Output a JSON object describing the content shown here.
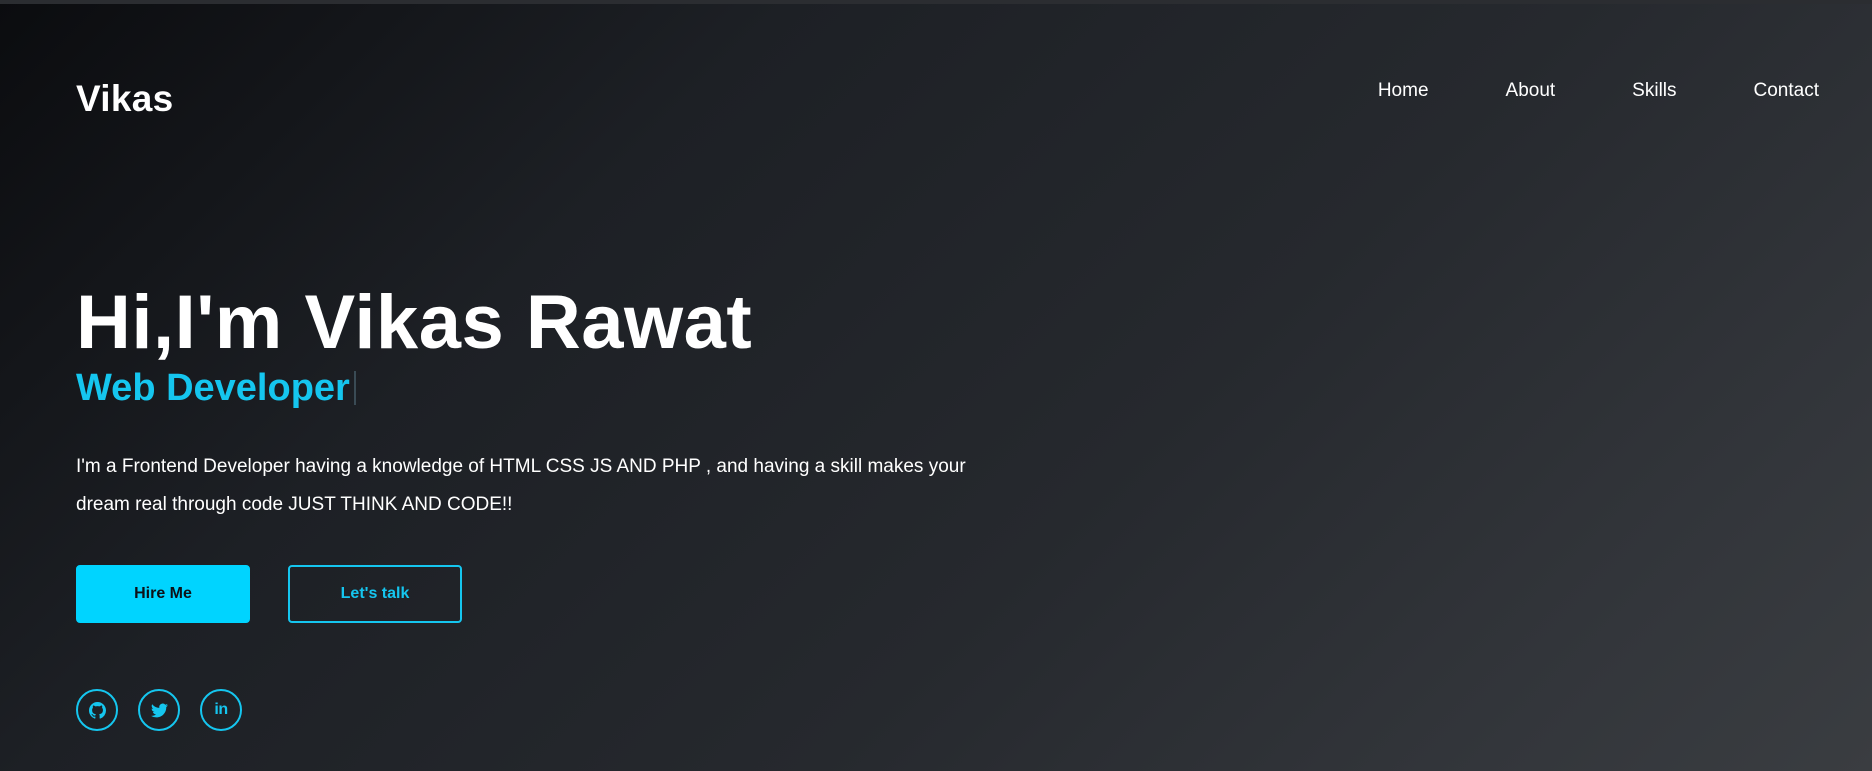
{
  "brand": {
    "logo_text": "Vikas"
  },
  "nav": {
    "items": [
      {
        "label": "Home"
      },
      {
        "label": "About"
      },
      {
        "label": "Skills"
      },
      {
        "label": "Contact"
      }
    ]
  },
  "hero": {
    "greeting": "Hi,I'm Vikas Rawat",
    "role": "Web Developer",
    "description": "I'm a Frontend Developer having a knowledge of HTML CSS JS AND PHP , and having a skill makes your dream real through code JUST THINK AND CODE!!"
  },
  "buttons": {
    "hire_label": "Hire Me",
    "talk_label": "Let's talk"
  },
  "socials": [
    {
      "icon": "github-icon"
    },
    {
      "icon": "twitter-icon"
    },
    {
      "icon": "linkedin-icon",
      "glyph": "in"
    }
  ],
  "colors": {
    "accent": "#00d4ff",
    "accent_text": "#15c6ef",
    "background_dark": "#0b0c0f",
    "background_light": "#3a3d41",
    "text": "#ffffff"
  }
}
